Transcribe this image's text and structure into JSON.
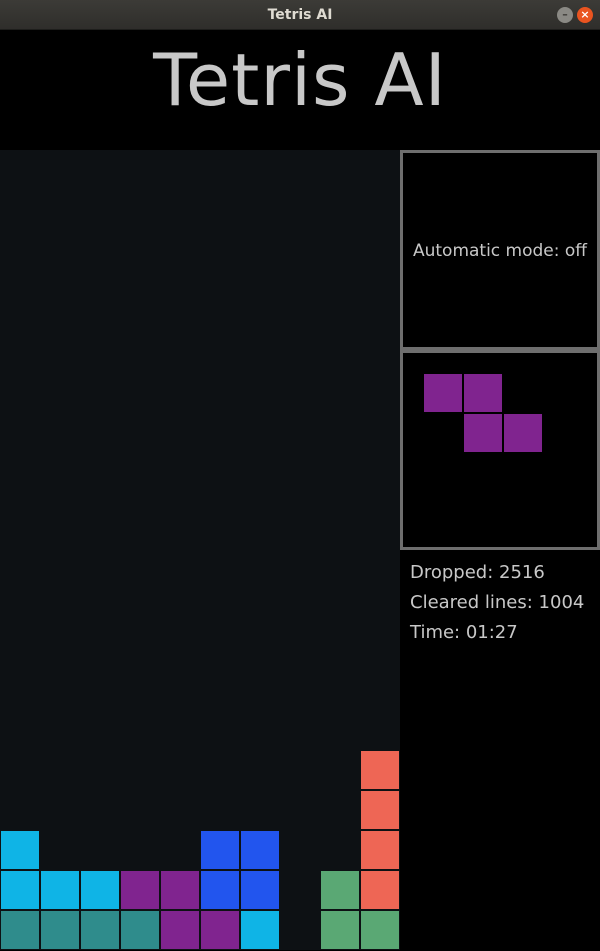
{
  "window": {
    "title": "Tetris AI",
    "minimize_glyph": "–",
    "close_glyph": "×"
  },
  "header": {
    "title": "Tetris AI"
  },
  "mode": {
    "text": "Automatic mode: off"
  },
  "stats": {
    "dropped": "Dropped: 2516",
    "cleared": "Cleared lines: 1004",
    "time": "Time: 01:27"
  },
  "colors": {
    "cyan": "#0fb4e6",
    "teal": "#2f8c8c",
    "purple": "#80248f",
    "blue": "#2255ee",
    "green": "#5aa874",
    "red": "#ee6655",
    "board_bg": "#0d1114"
  },
  "board": {
    "columns": 10,
    "rows": 20,
    "cells": [
      {
        "col": 9,
        "row": 15,
        "color": "red"
      },
      {
        "col": 9,
        "row": 16,
        "color": "red"
      },
      {
        "col": 0,
        "row": 17,
        "color": "cyan"
      },
      {
        "col": 5,
        "row": 17,
        "color": "blue"
      },
      {
        "col": 6,
        "row": 17,
        "color": "blue"
      },
      {
        "col": 9,
        "row": 17,
        "color": "red"
      },
      {
        "col": 0,
        "row": 18,
        "color": "cyan"
      },
      {
        "col": 1,
        "row": 18,
        "color": "cyan"
      },
      {
        "col": 2,
        "row": 18,
        "color": "cyan"
      },
      {
        "col": 3,
        "row": 18,
        "color": "purple"
      },
      {
        "col": 4,
        "row": 18,
        "color": "purple"
      },
      {
        "col": 5,
        "row": 18,
        "color": "blue"
      },
      {
        "col": 6,
        "row": 18,
        "color": "blue"
      },
      {
        "col": 8,
        "row": 18,
        "color": "green"
      },
      {
        "col": 9,
        "row": 18,
        "color": "red"
      },
      {
        "col": 0,
        "row": 19,
        "color": "teal"
      },
      {
        "col": 1,
        "row": 19,
        "color": "teal"
      },
      {
        "col": 2,
        "row": 19,
        "color": "teal"
      },
      {
        "col": 3,
        "row": 19,
        "color": "teal"
      },
      {
        "col": 4,
        "row": 19,
        "color": "purple"
      },
      {
        "col": 5,
        "row": 19,
        "color": "purple"
      },
      {
        "col": 6,
        "row": 19,
        "color": "cyan"
      },
      {
        "col": 8,
        "row": 19,
        "color": "green"
      },
      {
        "col": 9,
        "row": 19,
        "color": "green"
      }
    ]
  },
  "next_piece": {
    "color": "purple",
    "cells": [
      {
        "col": 0,
        "row": 0
      },
      {
        "col": 1,
        "row": 0
      },
      {
        "col": 1,
        "row": 1
      },
      {
        "col": 2,
        "row": 1
      }
    ]
  }
}
